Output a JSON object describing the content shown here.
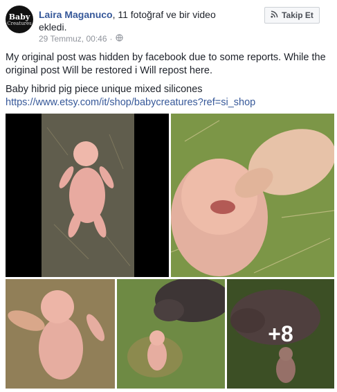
{
  "post": {
    "author": "Laira Maganuco",
    "action": ", 11 fotoğraf ve bir video ekledi.",
    "timestamp": "29 Temmuz, 00:46",
    "separator": "·",
    "follow_label": "Takip Et",
    "avatar_logo_line1": "Baby",
    "avatar_logo_line2": "Creatures",
    "text_line1": "My original post was hidden by facebook due to some reports. While the original post Will be restored i Will repost here.",
    "text_line2": "Baby hibrid pig piece unique mixed silicones",
    "link": "https://www.etsy.com/it/shop/babycreatures?ref=si_shop"
  },
  "gallery": {
    "more_count": "+8"
  },
  "icons": {
    "globe": "globe-icon",
    "follow": "rss-follow-icon"
  },
  "colors": {
    "link": "#365899",
    "meta": "#90949c",
    "text": "#1d2129"
  }
}
